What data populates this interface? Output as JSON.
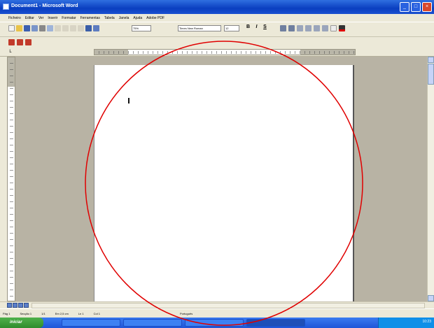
{
  "window": {
    "title": "Document1 - Microsoft Word"
  },
  "menubar": {
    "items": [
      "Ficheiro",
      "Editar",
      "Ver",
      "Inserir",
      "Formatar",
      "Ferramentas",
      "Tabela",
      "Janela",
      "Ajuda",
      "Adobe PDF"
    ]
  },
  "toolbar": {
    "zoom": "75%",
    "font": "Times New Roman",
    "font_size": "12",
    "bold": "B",
    "italic": "I",
    "underline": "S"
  },
  "statusbar": {
    "page": "Pág 1",
    "section": "Secção 1",
    "pages": "1/1",
    "position": "Em 2,5 cm",
    "line": "Ln 1",
    "column": "Col 1",
    "language": "Português"
  },
  "taskbar": {
    "start": "iniciar",
    "clock": "10:23"
  },
  "colors": {
    "titlebar": "#0a3fc0",
    "page_background": "#b8b3a4",
    "annotation_circle": "#e00000"
  }
}
